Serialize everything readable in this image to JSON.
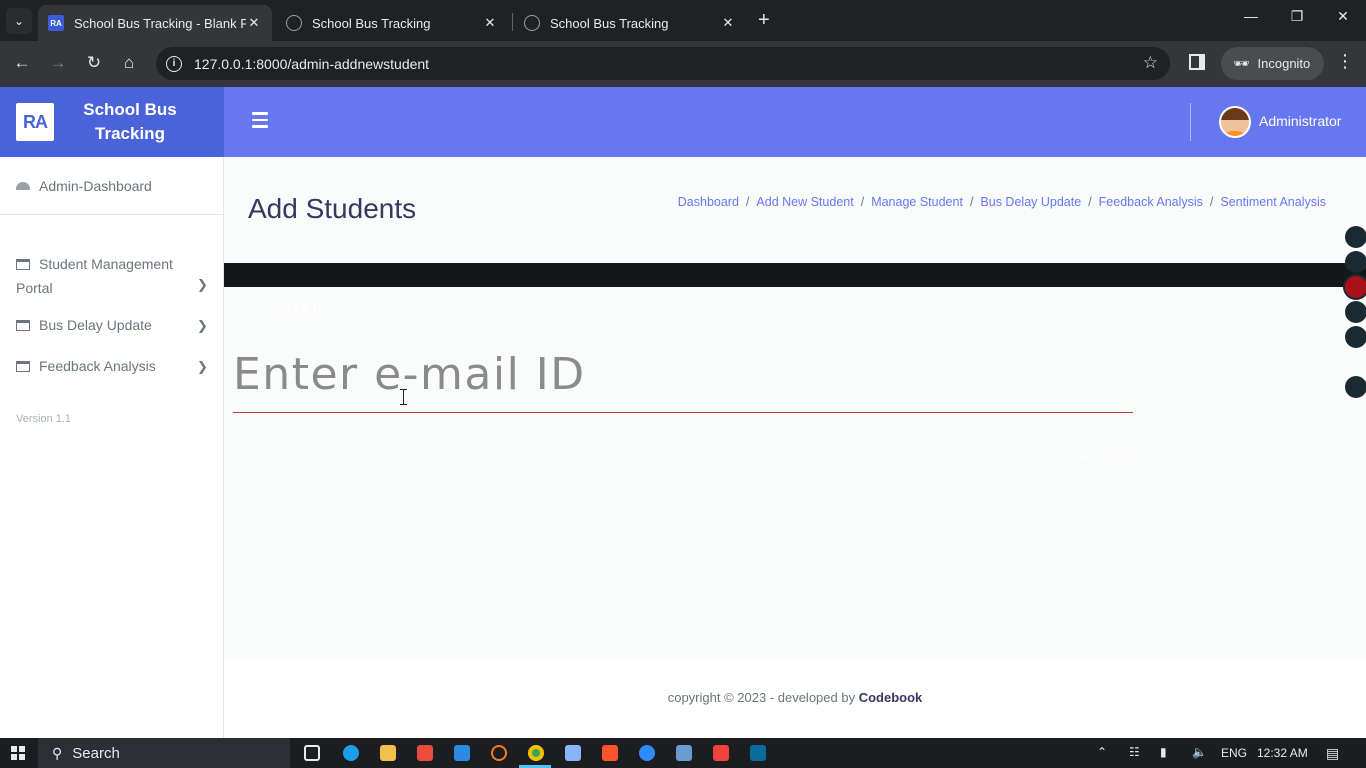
{
  "browser": {
    "tabs": [
      {
        "title": "School Bus Tracking - Blank Pa",
        "active": true,
        "favicon": "ra-logo"
      },
      {
        "title": "School Bus Tracking",
        "active": false,
        "favicon": "globe-icon"
      },
      {
        "title": "School Bus Tracking",
        "active": false,
        "favicon": "globe-icon"
      }
    ],
    "url": "127.0.0.1:8000/admin-addnewstudent",
    "incognito_label": "Incognito"
  },
  "brand": {
    "logo_text": "RA",
    "name": "School Bus Tracking"
  },
  "header": {
    "user_name": "Administrator"
  },
  "sidebar": {
    "items": [
      {
        "label": "Admin-Dashboard",
        "icon": "dashboard-icon"
      },
      {
        "label": "Student Management Portal",
        "icon": "window-icon"
      },
      {
        "label": "Bus Delay Update",
        "icon": "window-icon"
      },
      {
        "label": "Feedback Analysis",
        "icon": "window-icon"
      }
    ],
    "version": "Version 1.1"
  },
  "main": {
    "title": "Add Students",
    "breadcrumbs": [
      "Dashboard",
      "Add New Student",
      "Manage Student",
      "Bus Delay Update",
      "Feedback Analysis",
      "Sentiment Analysis"
    ],
    "form": {
      "email_label": "EMAIL",
      "email_placeholder": "Enter e-mail ID",
      "email_value": "",
      "submit_label": "PROCEED"
    }
  },
  "footer": {
    "text": "copyright © 2023 - developed by",
    "brand": "Codebook"
  },
  "taskbar": {
    "search_label": "Search",
    "language": "ENG",
    "time": "12:32 AM"
  },
  "colors": {
    "brand": "#4a63d9",
    "topnav": "#6777ef",
    "link": "#6777ef",
    "input_underline": "#c0393b",
    "dark_bar": "#15181b"
  }
}
